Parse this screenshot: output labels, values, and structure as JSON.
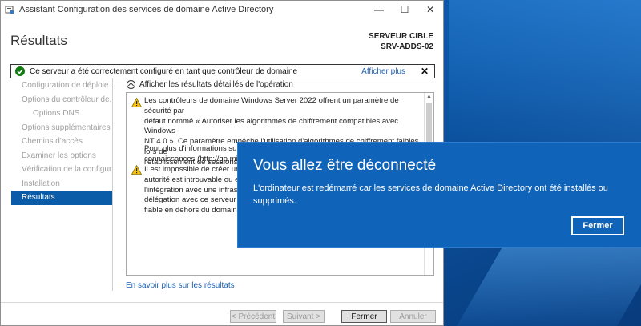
{
  "window": {
    "title": "Assistant Configuration des services de domaine Active Directory",
    "minimize_glyph": "—",
    "maximize_glyph": "☐",
    "close_glyph": "✕"
  },
  "page": {
    "title": "Résultats",
    "target_label": "SERVEUR CIBLE",
    "target_server": "SRV-ADDS-02"
  },
  "status": {
    "message": "Ce serveur a été correctement configuré en tant que contrôleur de domaine",
    "show_more": "Afficher plus",
    "close_glyph": "✕",
    "color": "#107c10"
  },
  "nav": {
    "items": [
      {
        "label": "Configuration de déploie..."
      },
      {
        "label": "Options du contrôleur de..."
      },
      {
        "label": "Options DNS"
      },
      {
        "label": "Options supplémentaires"
      },
      {
        "label": "Chemins d'accès"
      },
      {
        "label": "Examiner les options"
      },
      {
        "label": "Vérification de la configur..."
      },
      {
        "label": "Installation"
      },
      {
        "label": "Résultats"
      }
    ],
    "active_index": 8
  },
  "details": {
    "expander_label": "Afficher les résultats détaillés de l'opération",
    "warning1_lines": [
      "Les contrôleurs de domaine Windows Server 2022 offrent un paramètre de sécurité par",
      "défaut nommé « Autoriser les algorithmes de chiffrement compatibles avec Windows",
      "NT 4.0 ». Ce paramètre empêche l'utilisation d'algorithmes de chiffrement faibles lors de",
      "l'établissement de sessions sur canal sécurisé."
    ],
    "info_lines": [
      "Pour plus d'informations sur ce",
      "connaissances (http://go.micro"
    ],
    "warning2_lines": [
      "Il est impossible de créer une d",
      "autorité est introuvable ou elle",
      "l'intégration avec une infrastru",
      "délégation avec ce serveur DN",
      "fiable en dehors du domaine «"
    ],
    "learn_more": "En savoir plus sur les résultats"
  },
  "buttons": {
    "previous": "< Précédent",
    "next": "Suivant >",
    "close": "Fermer",
    "cancel": "Annuler"
  },
  "notification": {
    "title": "Vous allez être déconnecté",
    "body": "L'ordinateur est redémarré car les services de domaine Active Directory ont été installés ou supprimés.",
    "button": "Fermer",
    "color": "#0f63b8"
  }
}
